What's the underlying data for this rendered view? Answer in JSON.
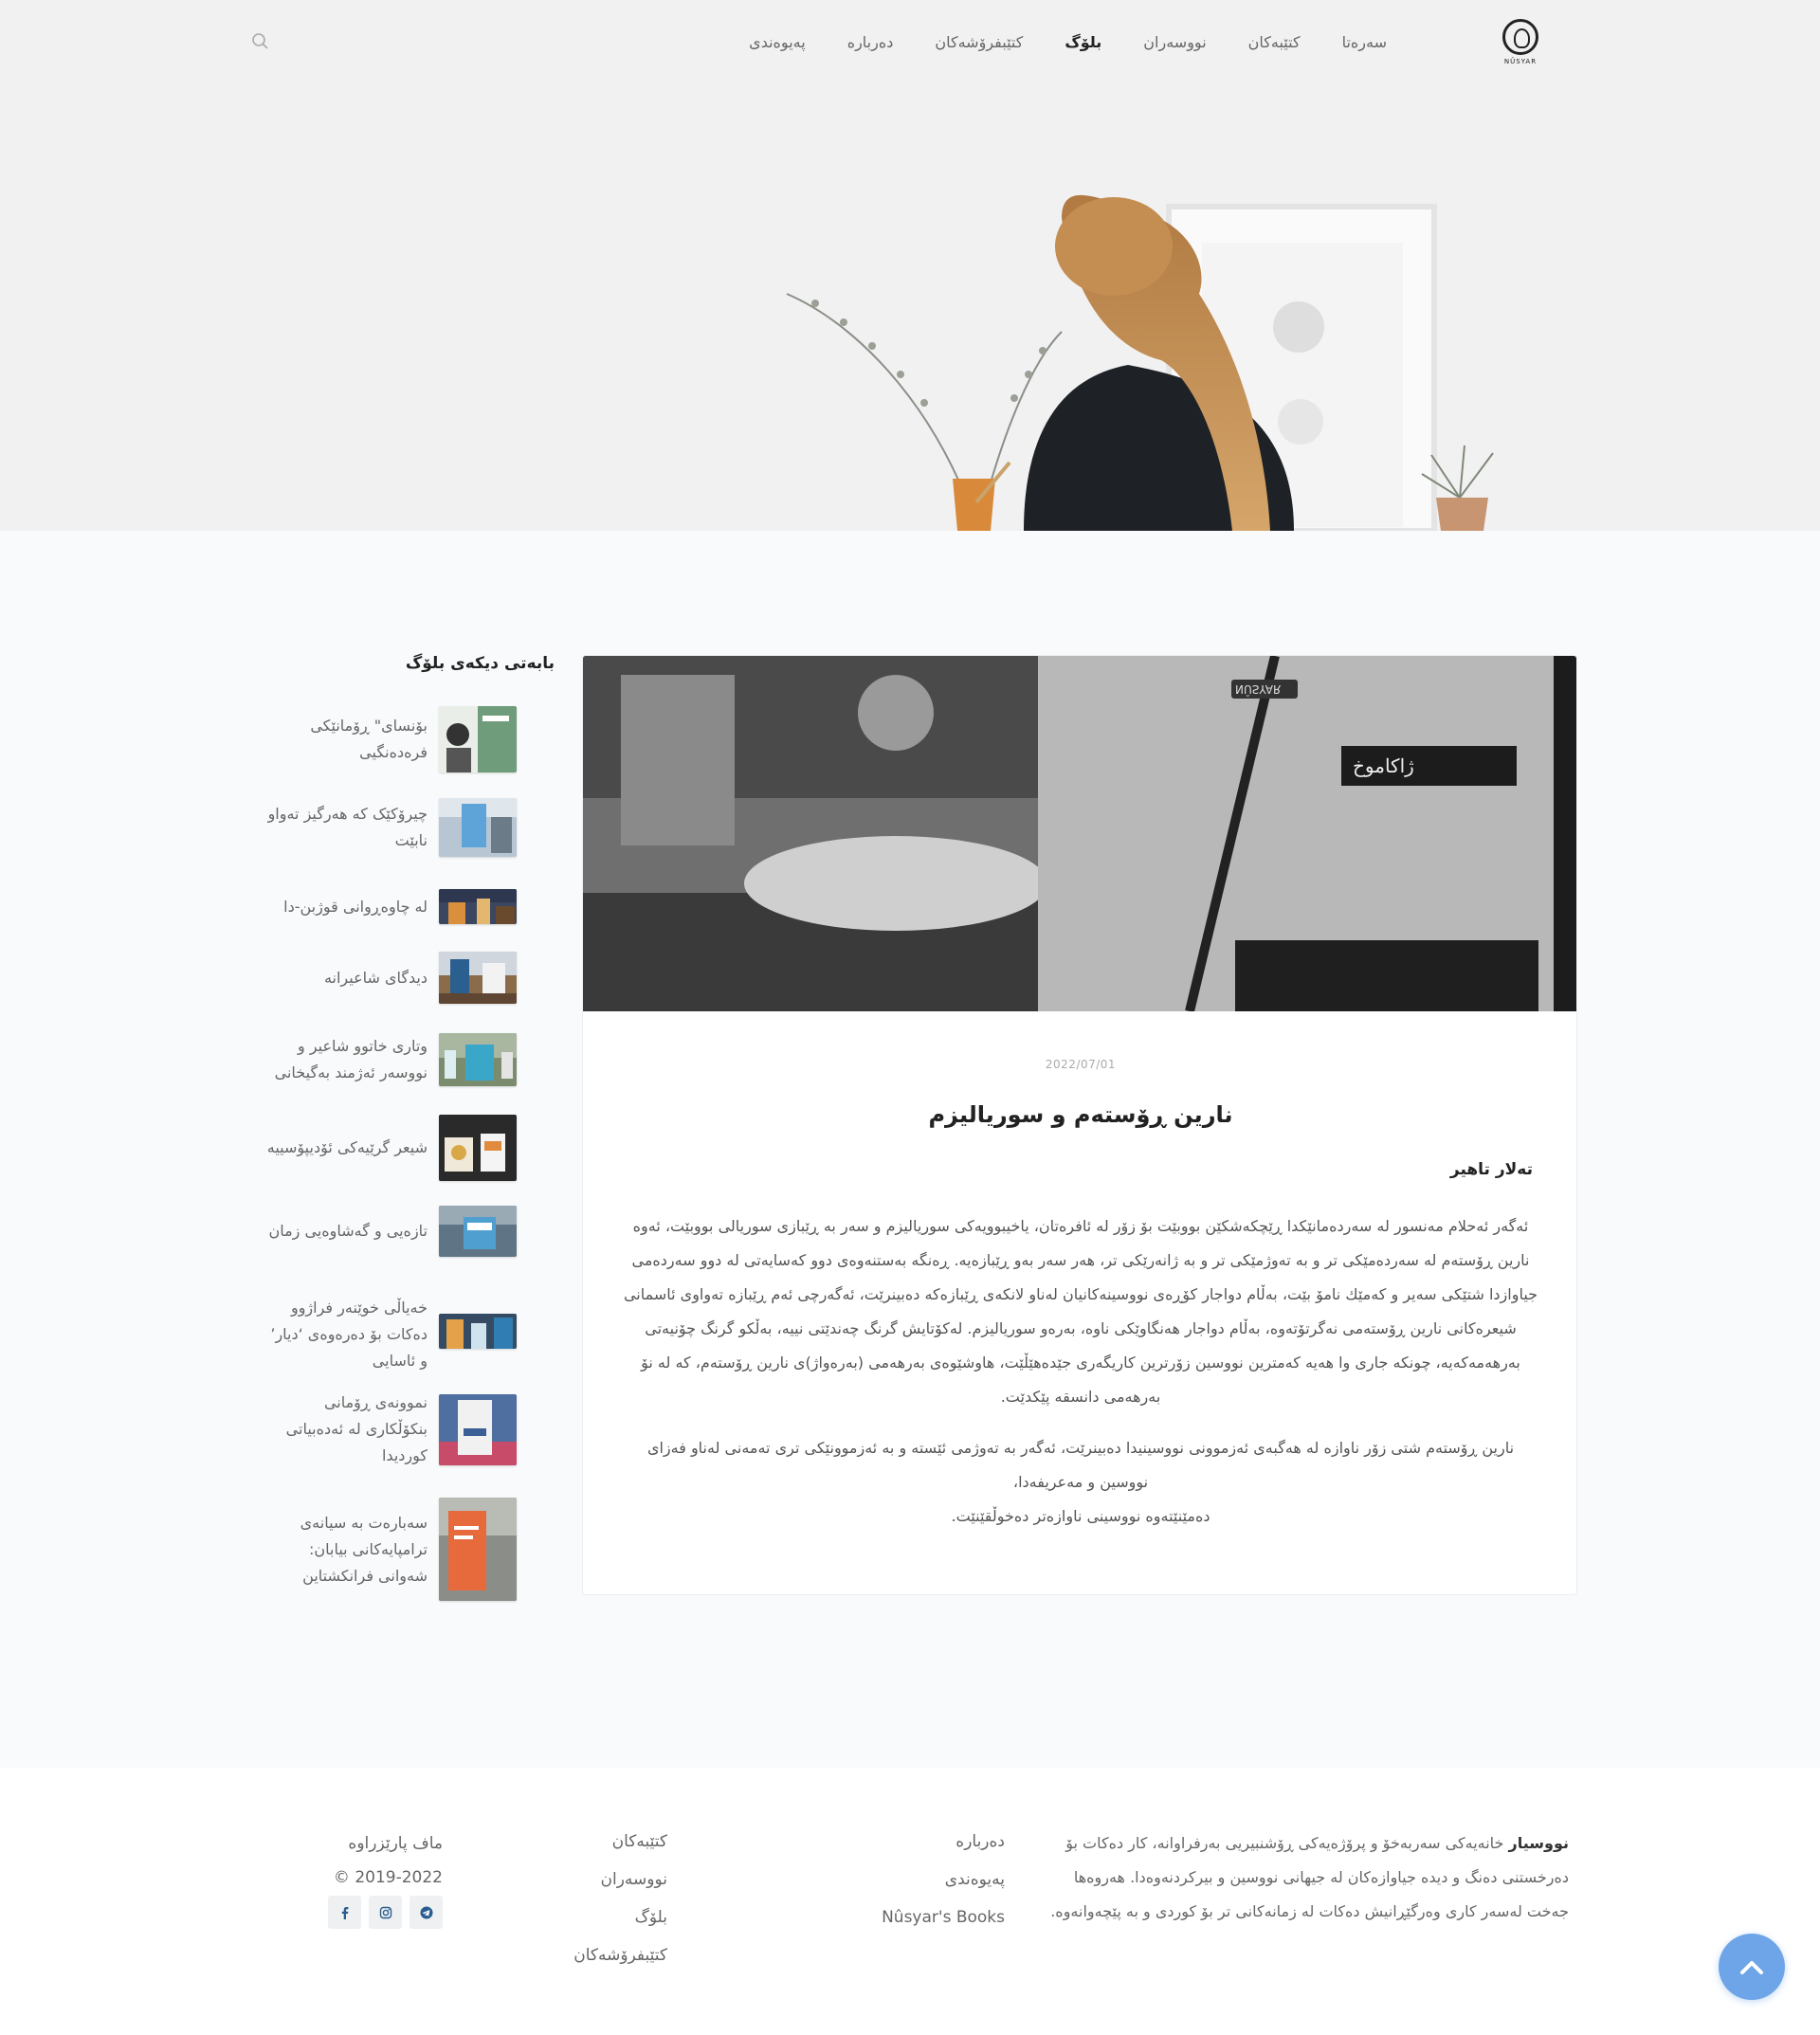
{
  "nav": {
    "logo_text": "NÛSYAR",
    "items": [
      {
        "label": "سەرەتا",
        "active": false
      },
      {
        "label": "کتێبەکان",
        "active": false
      },
      {
        "label": "نووسەران",
        "active": false
      },
      {
        "label": "بلۆگ",
        "active": true
      },
      {
        "label": "کتێبفرۆشەکان",
        "active": false
      },
      {
        "label": "دەربارە",
        "active": false
      },
      {
        "label": "پەیوەندی",
        "active": false
      }
    ],
    "search_icon": "search-icon"
  },
  "sidebar": {
    "title": "بابەتی دیکەی بلۆگ",
    "items": [
      {
        "label": "بۆنسای\" ڕۆمانێکی فرەدەنگیی"
      },
      {
        "label": "چیرۆکێک کە هەرگیز تەواو نابێت"
      },
      {
        "label": "لە چاوەڕوانی قوژبن-دا"
      },
      {
        "label": "دیدگای شاعیرانە"
      },
      {
        "label": "وتاری خاتوو شاعیر و نووسەر ئەژمند بەگیخانی"
      },
      {
        "label": "شیعر گرێیەکی ئۆدیپۆسییە"
      },
      {
        "label": "تازەیی و گەشاوەیی زمان"
      },
      {
        "label": "خەیاڵی خوێنەر فراژوو دەکات بۆ دەرەوەی ‘دیار’ و ئاسایی"
      },
      {
        "label": "نموونەی ڕۆمانی بنکۆڵکاری لە ئەدەبیاتی کوردیدا"
      },
      {
        "label": "سەبارەت بە سیانەی ترامپایەکانی بیابان: شەوانی فرانکشتاین"
      }
    ]
  },
  "post": {
    "cover_badge": "NÛSYAR",
    "cover_tag": "ژاکاموخ",
    "date": "2022/07/01",
    "title": "نارین ڕۆستەم و سوریالیزم",
    "author": "تەلار تاهیر",
    "paragraphs": [
      "ئەگەر ئەحلام مەنسور لە سەردەمانێکدا ڕێچکەشکێن بووبێت بۆ زۆر لە ئافرەتان، یاخیبوویەکی سوریالیزم و سەر بە ڕێبازی سوریالی بووبێت، ئەوە نارین ڕۆستەم لە سەردەمێکی تر و بە تەوژمێکی تر و بە ژانەرێکی تر، هەر سەر بەو ڕێبازەیە. ڕەنگە بەستنەوەی دوو کەسایەتی لە دوو سەردەمی جیاوازدا شتێکی سەیر و کەمێك نامۆ بێت، بەڵام دواجار کۆڕەی نووسینەکانیان لەناو لانکەی ڕێبازەکە دەبینرێت، ئەگەرچی ئەم ڕێبازە تەواوی ئاسمانی شیعرەکانی نارین ڕۆستەمی نەگرتۆتەوە، بەڵام دواجار هەنگاوێکی ناوە، بەرەو سوریالیزم. لەکۆتایش گرنگ چەندێتی نییە، بەڵکو گرنگ چۆنیەتی بەرهەمەکەیە، چونکە جاری وا هەیە کەمترین نووسین زۆرترین کاریگەری جێدەهێڵێت، هاوشێوەی بەرهەمی (بەرەواژ)ی نارین ڕۆستەم، کە لە نۆ بەرهەمی دانسقە پێکدێت.",
      "نارین ڕۆستەم شتی زۆر ناوازە لە هەگبەی ئەزموونی نووسینیدا دەبینرێت، ئەگەر بە تەوژمی ئێستە و بە ئەزموونێکی تری تەمەنی لەناو فەزای نووسین و مەعریفەدا،",
      "دەمێنێتەوە نووسینی ناوازەتر دەخوڵقێنێت."
    ]
  },
  "footer": {
    "brand": "نووسیار",
    "about": " خانەیەکی سەربەخۆ و پرۆژەیەکی ڕۆشنبیریی بەرفراوانە، کار دەکات بۆ دەرخستنی دەنگ و دیدە جیاوازەکان لە جیهانی نووسین و بیرکردنەوەدا. هەروەها جەخت لەسەر کاری وەرگێڕانیش دەکات لە زمانەکانی تر بۆ کوردی و بە پێچەوانەوە.",
    "col1": [
      "دەربارە",
      "پەیوەندی",
      "Nûsyar's Books"
    ],
    "col2": [
      "کتێبەکان",
      "نووسەران",
      "بلۆگ",
      "کتێبفرۆشەکان"
    ],
    "rights": "ماف پارێزراوە",
    "copyright": "© 2019-2022",
    "socials": [
      "facebook-icon",
      "instagram-icon",
      "telegram-icon"
    ]
  },
  "colors": {
    "accent": "#6ea5e8",
    "text": "#555555",
    "heading": "#222222"
  }
}
